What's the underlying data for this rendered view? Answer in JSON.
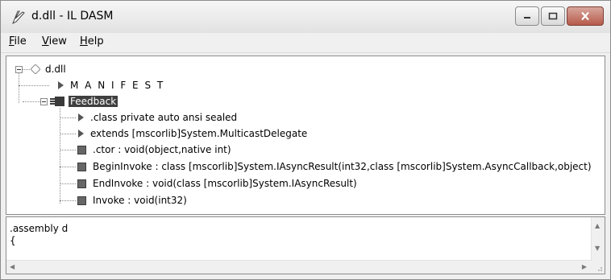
{
  "window": {
    "title": "d.dll - IL DASM"
  },
  "menu": {
    "items": [
      {
        "underline": "F",
        "rest": "ile"
      },
      {
        "underline": "V",
        "rest": "iew"
      },
      {
        "underline": "H",
        "rest": "elp"
      }
    ]
  },
  "tree": {
    "root": "d.dll",
    "manifest": "M A N I F E S T",
    "class_name": "Feedback",
    "members": [
      {
        "icon": "triangle",
        "label": ".class private auto ansi sealed"
      },
      {
        "icon": "triangle",
        "label": " extends [mscorlib]System.MulticastDelegate"
      },
      {
        "icon": "method",
        "label": ".ctor : void(object,native int)"
      },
      {
        "icon": "method",
        "label": "BeginInvoke : class [mscorlib]System.IAsyncResult(int32,class [mscorlib]System.AsyncCallback,object)"
      },
      {
        "icon": "method",
        "label": "EndInvoke : void(class [mscorlib]System.IAsyncResult)"
      },
      {
        "icon": "method",
        "label": "Invoke : void(int32)"
      }
    ]
  },
  "text_panel": {
    "lines": [
      ".assembly d",
      "{"
    ]
  }
}
